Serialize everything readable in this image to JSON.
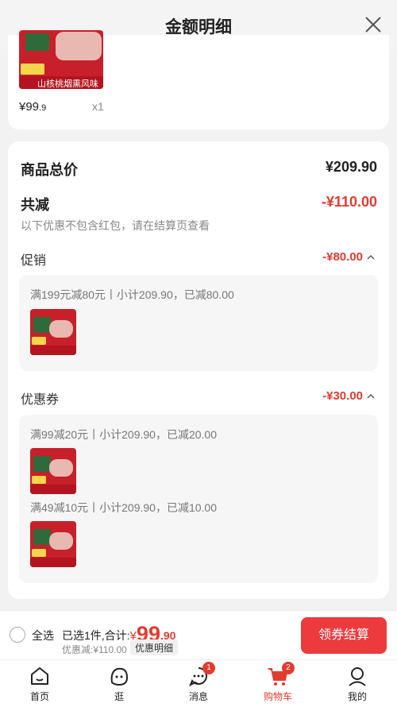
{
  "header": {
    "title": "金额明细"
  },
  "product": {
    "price_int": "¥99",
    "price_dec": ".9",
    "qty": "x1",
    "image_text": "山核桃烟熏风味"
  },
  "totals": {
    "goods_total_label": "商品总价",
    "goods_total_value": "¥209.90",
    "reduce_label": "共减",
    "reduce_value": "-¥110.00",
    "note": "以下优惠不包含红包，请在结算页查看"
  },
  "promotion": {
    "title": "促销",
    "amount": "-¥80.00",
    "rule": "满199元减80元丨小计209.90，已减80.00"
  },
  "coupon": {
    "title": "优惠券",
    "amount": "-¥30.00",
    "rule1": "满99减20元丨小计209.90，已减20.00",
    "rule2": "满49减10元丨小计209.90，已减10.00"
  },
  "footer": {
    "select_all": "全选",
    "summary_prefix": "已选1件,合计:",
    "cur": "¥",
    "total_int": "99",
    "total_dec": ".90",
    "discount": "优惠减:¥110.00",
    "detail": "优惠明细",
    "checkout": "领券结算"
  },
  "tabs": [
    {
      "label": "首页",
      "icon": "home-icon"
    },
    {
      "label": "逛",
      "icon": "stroll-face-icon"
    },
    {
      "label": "消息",
      "icon": "message-icon",
      "badge": "1"
    },
    {
      "label": "购物车",
      "icon": "cart-icon",
      "badge": "2",
      "active": true
    },
    {
      "label": "我的",
      "icon": "profile-icon"
    }
  ],
  "colors": {
    "accent": "#e23b30",
    "button": "#ec3a3d"
  }
}
